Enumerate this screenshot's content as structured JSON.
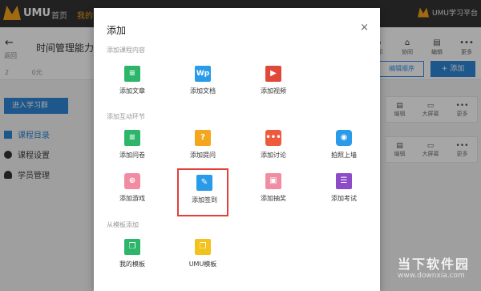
{
  "topbar": {
    "logo": "UMU",
    "nav": [
      "首页",
      "我的"
    ],
    "platform": "UMU学习平台"
  },
  "course": {
    "back_label": "返回",
    "title": "时间管理能力提",
    "stats": [
      "2",
      "0元"
    ],
    "tools": [
      {
        "icon": "display-icon",
        "label": "展示"
      },
      {
        "icon": "share-icon",
        "label": "协同"
      },
      {
        "icon": "edit-icon",
        "label": "编辑"
      },
      {
        "icon": "more-icon",
        "label": "更多"
      }
    ],
    "edit_button": "编辑顺序",
    "add_button": "+ 添加"
  },
  "sidebar": {
    "enter_button": "进入学习群",
    "items": [
      {
        "label": "课程目录",
        "active": true
      },
      {
        "label": "课程设置",
        "active": false
      },
      {
        "label": "学员管理",
        "active": false
      }
    ]
  },
  "cards": [
    {
      "actions": [
        "编辑",
        "大屏幕",
        "更多"
      ]
    },
    {
      "actions": [
        "编辑",
        "大屏幕",
        "更多"
      ]
    }
  ],
  "modal": {
    "title": "添加",
    "close": "×",
    "sections": [
      {
        "label": "添加课程内容",
        "items": [
          {
            "label": "添加文章",
            "icon": "article-icon",
            "glyph": "≡"
          },
          {
            "label": "添加文档",
            "icon": "document-icon",
            "glyph": "Wp"
          },
          {
            "label": "添加视频",
            "icon": "video-icon",
            "glyph": "▶"
          }
        ]
      },
      {
        "label": "添加互动环节",
        "items": [
          {
            "label": "添加问卷",
            "icon": "survey-icon",
            "glyph": "≡"
          },
          {
            "label": "添加提问",
            "icon": "question-icon",
            "glyph": "?"
          },
          {
            "label": "添加讨论",
            "icon": "discussion-icon",
            "glyph": "•••"
          },
          {
            "label": "拍照上墙",
            "icon": "camera-icon",
            "glyph": "◉"
          },
          {
            "label": "添加游戏",
            "icon": "game-icon",
            "glyph": "⊕"
          },
          {
            "label": "添加签到",
            "icon": "signin-icon",
            "glyph": "✎",
            "highlighted": true
          },
          {
            "label": "添加抽奖",
            "icon": "lottery-icon",
            "glyph": "▣"
          },
          {
            "label": "添加考试",
            "icon": "exam-icon",
            "glyph": "☰"
          }
        ]
      },
      {
        "label": "从模板添加",
        "items": [
          {
            "label": "我的模板",
            "icon": "my-template-icon",
            "glyph": "❐"
          },
          {
            "label": "UMU模板",
            "icon": "umu-template-icon",
            "glyph": "❐"
          }
        ]
      }
    ]
  },
  "watermark": {
    "text": "当下软件园",
    "url": "www.downxia.com"
  }
}
